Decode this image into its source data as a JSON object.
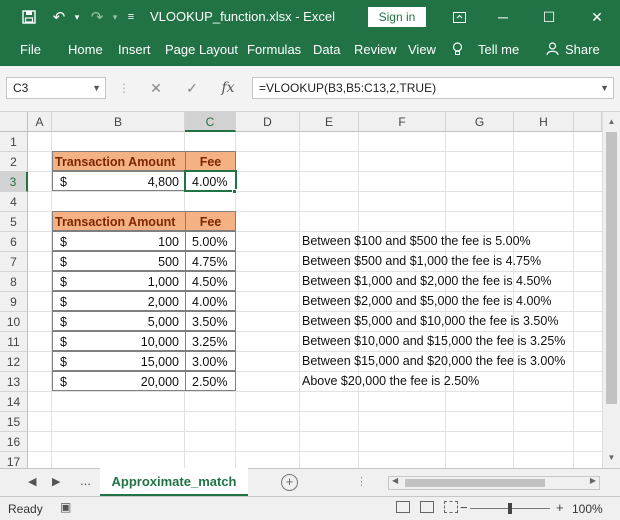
{
  "window": {
    "title": "VLOOKUP_function.xlsx  -  Excel",
    "sign_in": "Sign in"
  },
  "menu": [
    "File",
    "Home",
    "Insert",
    "Page Layout",
    "Formulas",
    "Data",
    "Review",
    "View",
    "Tell me",
    "Share"
  ],
  "name_box": "C3",
  "formula": "=VLOOKUP(B3,B5:C13,2,TRUE)",
  "columns": [
    "A",
    "B",
    "C",
    "D",
    "E",
    "F",
    "G",
    "H"
  ],
  "rows": [
    "1",
    "2",
    "3",
    "4",
    "5",
    "6",
    "7",
    "8",
    "9",
    "10",
    "11",
    "12",
    "13",
    "14",
    "15",
    "16",
    "17"
  ],
  "lookup_table": {
    "header_amount": "Transaction Amount",
    "header_fee": "Fee",
    "currency": "$",
    "amount": "4,800",
    "fee": "4.00%"
  },
  "fee_table": {
    "header_amount": "Transaction Amount",
    "header_fee": "Fee",
    "rows": [
      {
        "currency": "$",
        "amount": "100",
        "fee": "5.00%"
      },
      {
        "currency": "$",
        "amount": "500",
        "fee": "4.75%"
      },
      {
        "currency": "$",
        "amount": "1,000",
        "fee": "4.50%"
      },
      {
        "currency": "$",
        "amount": "2,000",
        "fee": "4.00%"
      },
      {
        "currency": "$",
        "amount": "5,000",
        "fee": "3.50%"
      },
      {
        "currency": "$",
        "amount": "10,000",
        "fee": "3.25%"
      },
      {
        "currency": "$",
        "amount": "15,000",
        "fee": "3.00%"
      },
      {
        "currency": "$",
        "amount": "20,000",
        "fee": "2.50%"
      }
    ]
  },
  "notes": [
    "Between $100 and $500 the fee is 5.00%",
    "Between $500 and $1,000 the fee is 4.75%",
    "Between $1,000 and $2,000 the fee is 4.50%",
    "Between $2,000 and $5,000 the fee is 4.00%",
    "Between $5,000 and $10,000 the fee is 3.50%",
    "Between $10,000 and $15,000 the fee is 3.25%",
    "Between $15,000 and $20,000 the fee is 3.00%",
    "Above $20,000 the fee is 2.50%"
  ],
  "sheet_tabs": {
    "more": "...",
    "active": "Approximate_match",
    "add": "+"
  },
  "status": {
    "ready": "Ready",
    "zoom": "100%"
  },
  "colors": {
    "excel_green": "#217346",
    "header_fill": "#f4b183",
    "header_text": "#7f2704"
  }
}
